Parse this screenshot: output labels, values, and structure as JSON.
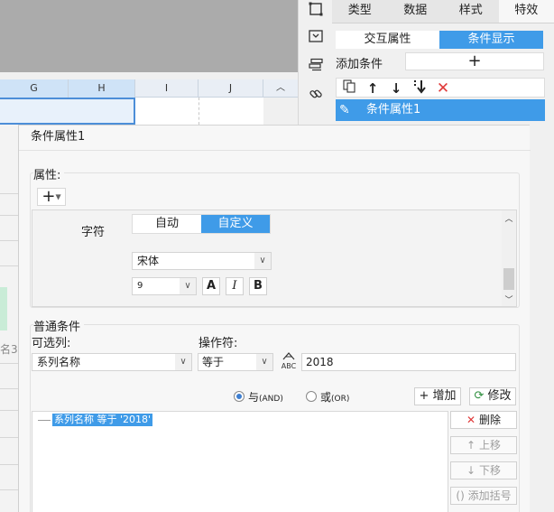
{
  "spreadsheet": {
    "columns": [
      "G",
      "H",
      "I",
      "J"
    ],
    "left_clipped_text": "名3"
  },
  "right_panel": {
    "tabs": [
      {
        "label": "类型",
        "active": false
      },
      {
        "label": "数据",
        "active": false
      },
      {
        "label": "样式",
        "active": false
      },
      {
        "label": "特效",
        "active": true
      }
    ],
    "subtabs": [
      {
        "label": "交互属性",
        "active": false
      },
      {
        "label": "条件显示",
        "active": true
      }
    ],
    "add_condition_label": "添加条件",
    "add_condition_button": "+",
    "condition_item": "条件属性1",
    "accent_color": "#3f9be8",
    "toolbar_icons": [
      "copy-icon",
      "arrow-up-icon",
      "arrow-down-icon",
      "move-bottom-icon",
      "delete-icon"
    ],
    "side_icons": [
      "frame-icon",
      "dropdown-box-icon",
      "layers-icon",
      "link-icon"
    ]
  },
  "dialog": {
    "title": "条件属性1",
    "attributes": {
      "section_label": "属性",
      "add_button": "+",
      "font_label": "字符",
      "mode_options": [
        {
          "label": "自动",
          "active": false
        },
        {
          "label": "自定义",
          "active": true
        }
      ],
      "font_name": "宋体",
      "font_size": "9",
      "format_buttons": [
        "A",
        "I",
        "B"
      ]
    },
    "normal_conditions": {
      "section_label": "普通条件",
      "column_label": "可选列:",
      "operator_label": "操作符:",
      "column_value": "系列名称",
      "operator_value": "等于",
      "value": "2018",
      "type_icon_text": "ABC",
      "radio_and": "与",
      "radio_and_sub": "(AND)",
      "radio_or": "或",
      "radio_or_sub": "(OR)",
      "add_label": "增加",
      "modify_label": "修改",
      "tree_item": "系列名称 等于 '2018'",
      "side_buttons": {
        "delete": "删除",
        "move_up": "上移",
        "move_down": "下移",
        "add_bracket": "添加括号"
      }
    }
  }
}
